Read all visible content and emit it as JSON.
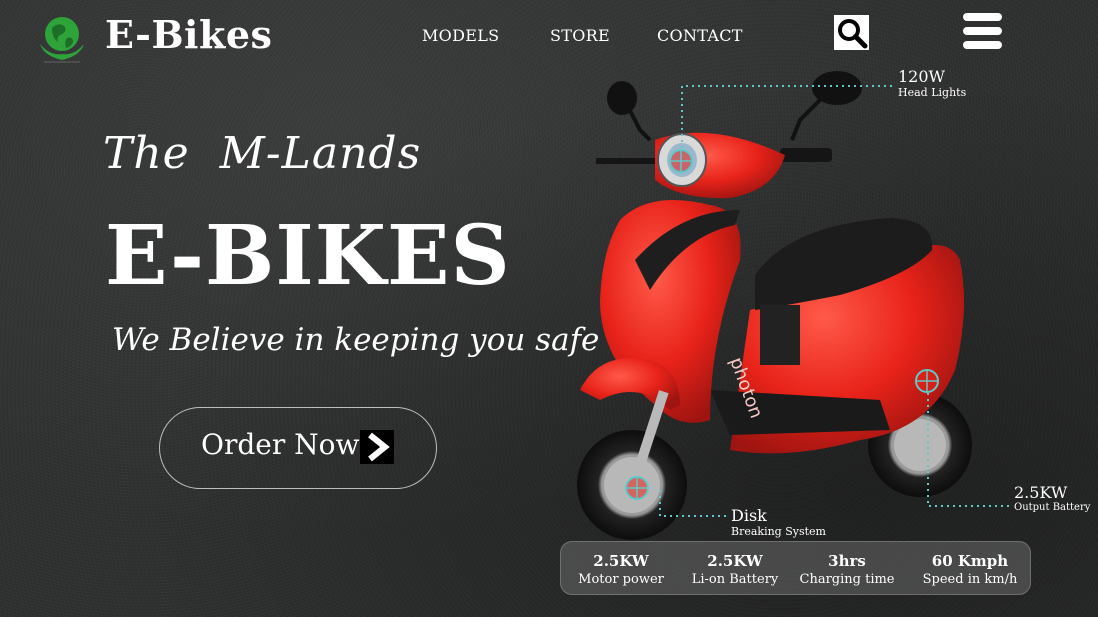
{
  "header": {
    "brand": "E-Bikes",
    "nav": [
      {
        "label": "MODELS"
      },
      {
        "label": "STORE"
      },
      {
        "label": "CONTACT"
      }
    ],
    "search_icon": "search-icon",
    "menu_icon": "hamburger-menu-icon"
  },
  "hero": {
    "pretitle": "The  M-Lands",
    "title": "E-BIKES",
    "tagline": "We Believe in keeping you safe",
    "cta_label": "Order Now",
    "cta_icon": "chevron-right-icon"
  },
  "callouts": {
    "headlights": {
      "value": "120W",
      "label": "Head Lights"
    },
    "brakes": {
      "value": "Disk",
      "label": "Breaking System"
    },
    "battery": {
      "value": "2.5KW",
      "label": "Output Battery"
    }
  },
  "specs": [
    {
      "value": "2.5KW",
      "label": "Motor power"
    },
    {
      "value": "2.5KW",
      "label": "Li-on Battery"
    },
    {
      "value": "3hrs",
      "label": "Charging time"
    },
    {
      "value": "60 Kmph",
      "label": "Speed in km/h"
    }
  ],
  "colors": {
    "background": "#2f3030",
    "scooter_red": "#e8231a",
    "callout_line": "#5fc9c9",
    "logo_green": "#2ea33a"
  }
}
